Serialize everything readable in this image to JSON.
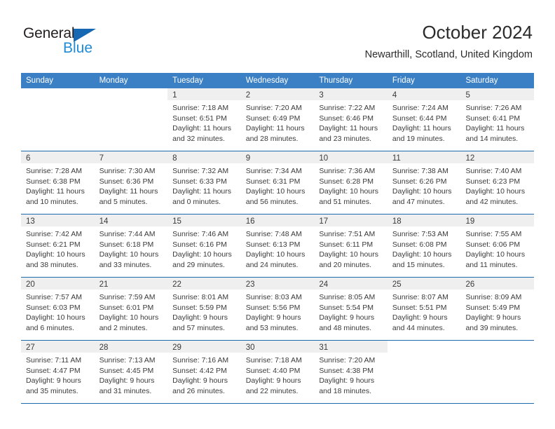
{
  "brand": {
    "name_top": "General",
    "name_bottom": "Blue",
    "triangle_color": "#1668b3",
    "blue_color": "#1f8ad6"
  },
  "header": {
    "title": "October 2024",
    "location": "Newarthill, Scotland, United Kingdom"
  },
  "theme": {
    "header_blue": "#3b80c4",
    "row_rule_blue": "#1d69ae",
    "date_band_gray": "#efefef",
    "text_color": "#3a3a3a"
  },
  "weekdays": [
    "Sunday",
    "Monday",
    "Tuesday",
    "Wednesday",
    "Thursday",
    "Friday",
    "Saturday"
  ],
  "weeks": [
    [
      {
        "date": "",
        "sunrise": "",
        "sunset": "",
        "daylight_1": "",
        "daylight_2": ""
      },
      {
        "date": "",
        "sunrise": "",
        "sunset": "",
        "daylight_1": "",
        "daylight_2": ""
      },
      {
        "date": "1",
        "sunrise": "Sunrise: 7:18 AM",
        "sunset": "Sunset: 6:51 PM",
        "daylight_1": "Daylight: 11 hours",
        "daylight_2": "and 32 minutes."
      },
      {
        "date": "2",
        "sunrise": "Sunrise: 7:20 AM",
        "sunset": "Sunset: 6:49 PM",
        "daylight_1": "Daylight: 11 hours",
        "daylight_2": "and 28 minutes."
      },
      {
        "date": "3",
        "sunrise": "Sunrise: 7:22 AM",
        "sunset": "Sunset: 6:46 PM",
        "daylight_1": "Daylight: 11 hours",
        "daylight_2": "and 23 minutes."
      },
      {
        "date": "4",
        "sunrise": "Sunrise: 7:24 AM",
        "sunset": "Sunset: 6:44 PM",
        "daylight_1": "Daylight: 11 hours",
        "daylight_2": "and 19 minutes."
      },
      {
        "date": "5",
        "sunrise": "Sunrise: 7:26 AM",
        "sunset": "Sunset: 6:41 PM",
        "daylight_1": "Daylight: 11 hours",
        "daylight_2": "and 14 minutes."
      }
    ],
    [
      {
        "date": "6",
        "sunrise": "Sunrise: 7:28 AM",
        "sunset": "Sunset: 6:38 PM",
        "daylight_1": "Daylight: 11 hours",
        "daylight_2": "and 10 minutes."
      },
      {
        "date": "7",
        "sunrise": "Sunrise: 7:30 AM",
        "sunset": "Sunset: 6:36 PM",
        "daylight_1": "Daylight: 11 hours",
        "daylight_2": "and 5 minutes."
      },
      {
        "date": "8",
        "sunrise": "Sunrise: 7:32 AM",
        "sunset": "Sunset: 6:33 PM",
        "daylight_1": "Daylight: 11 hours",
        "daylight_2": "and 0 minutes."
      },
      {
        "date": "9",
        "sunrise": "Sunrise: 7:34 AM",
        "sunset": "Sunset: 6:31 PM",
        "daylight_1": "Daylight: 10 hours",
        "daylight_2": "and 56 minutes."
      },
      {
        "date": "10",
        "sunrise": "Sunrise: 7:36 AM",
        "sunset": "Sunset: 6:28 PM",
        "daylight_1": "Daylight: 10 hours",
        "daylight_2": "and 51 minutes."
      },
      {
        "date": "11",
        "sunrise": "Sunrise: 7:38 AM",
        "sunset": "Sunset: 6:26 PM",
        "daylight_1": "Daylight: 10 hours",
        "daylight_2": "and 47 minutes."
      },
      {
        "date": "12",
        "sunrise": "Sunrise: 7:40 AM",
        "sunset": "Sunset: 6:23 PM",
        "daylight_1": "Daylight: 10 hours",
        "daylight_2": "and 42 minutes."
      }
    ],
    [
      {
        "date": "13",
        "sunrise": "Sunrise: 7:42 AM",
        "sunset": "Sunset: 6:21 PM",
        "daylight_1": "Daylight: 10 hours",
        "daylight_2": "and 38 minutes."
      },
      {
        "date": "14",
        "sunrise": "Sunrise: 7:44 AM",
        "sunset": "Sunset: 6:18 PM",
        "daylight_1": "Daylight: 10 hours",
        "daylight_2": "and 33 minutes."
      },
      {
        "date": "15",
        "sunrise": "Sunrise: 7:46 AM",
        "sunset": "Sunset: 6:16 PM",
        "daylight_1": "Daylight: 10 hours",
        "daylight_2": "and 29 minutes."
      },
      {
        "date": "16",
        "sunrise": "Sunrise: 7:48 AM",
        "sunset": "Sunset: 6:13 PM",
        "daylight_1": "Daylight: 10 hours",
        "daylight_2": "and 24 minutes."
      },
      {
        "date": "17",
        "sunrise": "Sunrise: 7:51 AM",
        "sunset": "Sunset: 6:11 PM",
        "daylight_1": "Daylight: 10 hours",
        "daylight_2": "and 20 minutes."
      },
      {
        "date": "18",
        "sunrise": "Sunrise: 7:53 AM",
        "sunset": "Sunset: 6:08 PM",
        "daylight_1": "Daylight: 10 hours",
        "daylight_2": "and 15 minutes."
      },
      {
        "date": "19",
        "sunrise": "Sunrise: 7:55 AM",
        "sunset": "Sunset: 6:06 PM",
        "daylight_1": "Daylight: 10 hours",
        "daylight_2": "and 11 minutes."
      }
    ],
    [
      {
        "date": "20",
        "sunrise": "Sunrise: 7:57 AM",
        "sunset": "Sunset: 6:03 PM",
        "daylight_1": "Daylight: 10 hours",
        "daylight_2": "and 6 minutes."
      },
      {
        "date": "21",
        "sunrise": "Sunrise: 7:59 AM",
        "sunset": "Sunset: 6:01 PM",
        "daylight_1": "Daylight: 10 hours",
        "daylight_2": "and 2 minutes."
      },
      {
        "date": "22",
        "sunrise": "Sunrise: 8:01 AM",
        "sunset": "Sunset: 5:59 PM",
        "daylight_1": "Daylight: 9 hours",
        "daylight_2": "and 57 minutes."
      },
      {
        "date": "23",
        "sunrise": "Sunrise: 8:03 AM",
        "sunset": "Sunset: 5:56 PM",
        "daylight_1": "Daylight: 9 hours",
        "daylight_2": "and 53 minutes."
      },
      {
        "date": "24",
        "sunrise": "Sunrise: 8:05 AM",
        "sunset": "Sunset: 5:54 PM",
        "daylight_1": "Daylight: 9 hours",
        "daylight_2": "and 48 minutes."
      },
      {
        "date": "25",
        "sunrise": "Sunrise: 8:07 AM",
        "sunset": "Sunset: 5:51 PM",
        "daylight_1": "Daylight: 9 hours",
        "daylight_2": "and 44 minutes."
      },
      {
        "date": "26",
        "sunrise": "Sunrise: 8:09 AM",
        "sunset": "Sunset: 5:49 PM",
        "daylight_1": "Daylight: 9 hours",
        "daylight_2": "and 39 minutes."
      }
    ],
    [
      {
        "date": "27",
        "sunrise": "Sunrise: 7:11 AM",
        "sunset": "Sunset: 4:47 PM",
        "daylight_1": "Daylight: 9 hours",
        "daylight_2": "and 35 minutes."
      },
      {
        "date": "28",
        "sunrise": "Sunrise: 7:13 AM",
        "sunset": "Sunset: 4:45 PM",
        "daylight_1": "Daylight: 9 hours",
        "daylight_2": "and 31 minutes."
      },
      {
        "date": "29",
        "sunrise": "Sunrise: 7:16 AM",
        "sunset": "Sunset: 4:42 PM",
        "daylight_1": "Daylight: 9 hours",
        "daylight_2": "and 26 minutes."
      },
      {
        "date": "30",
        "sunrise": "Sunrise: 7:18 AM",
        "sunset": "Sunset: 4:40 PM",
        "daylight_1": "Daylight: 9 hours",
        "daylight_2": "and 22 minutes."
      },
      {
        "date": "31",
        "sunrise": "Sunrise: 7:20 AM",
        "sunset": "Sunset: 4:38 PM",
        "daylight_1": "Daylight: 9 hours",
        "daylight_2": "and 18 minutes."
      },
      {
        "date": "",
        "sunrise": "",
        "sunset": "",
        "daylight_1": "",
        "daylight_2": ""
      },
      {
        "date": "",
        "sunrise": "",
        "sunset": "",
        "daylight_1": "",
        "daylight_2": ""
      }
    ]
  ]
}
